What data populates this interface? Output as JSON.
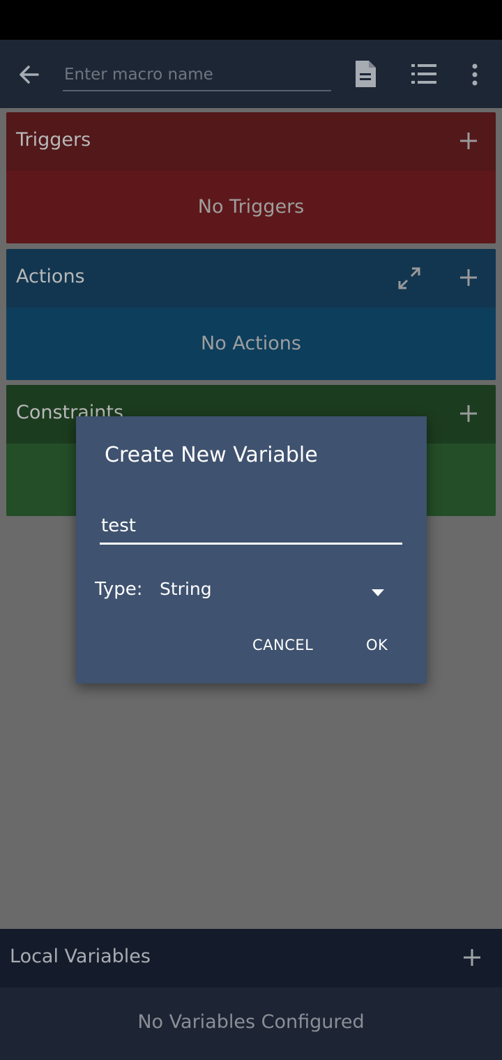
{
  "toolbar": {
    "name_placeholder": "Enter macro name",
    "icons": [
      "back-arrow-icon",
      "document-icon",
      "list-icon",
      "more-vert-icon"
    ]
  },
  "sections": {
    "triggers": {
      "title": "Triggers",
      "empty": "No Triggers",
      "color": "#5e181b"
    },
    "actions": {
      "title": "Actions",
      "empty": "No Actions",
      "color": "#0d3e5c"
    },
    "constraints": {
      "title": "Constraints",
      "empty": "",
      "color": "#244e28"
    }
  },
  "local_variables": {
    "title": "Local Variables",
    "empty": "No Variables Configured"
  },
  "dialog": {
    "title": "Create New Variable",
    "name_value": "test",
    "type_label": "Type:",
    "type_value": "String",
    "cancel_label": "CANCEL",
    "ok_label": "OK",
    "background": "#3f526f"
  }
}
